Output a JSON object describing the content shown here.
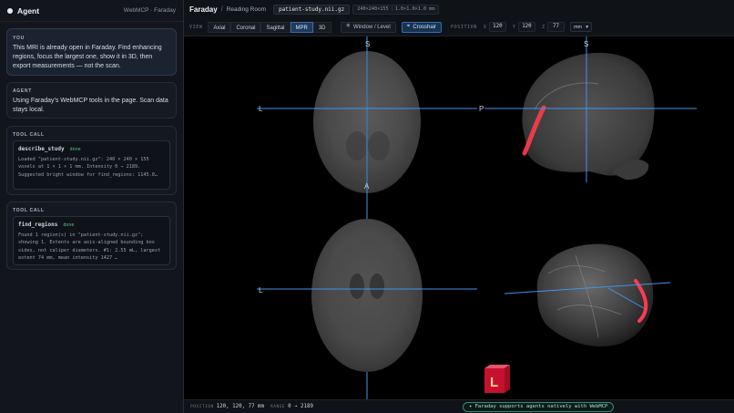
{
  "agent_panel": {
    "title": "Agent",
    "meta": "WebMCP · Faraday",
    "user_message": {
      "label": "YOU",
      "text": "This MRI is already open in Faraday. Find enhancing regions, focus the largest one, show it in 3D, then export measurements — not the scan."
    },
    "agent_message": {
      "label": "AGENT",
      "text": "Using Faraday's WebMCP tools in the page. Scan data stays local."
    },
    "tool_calls": [
      {
        "label": "TOOL CALL",
        "name": "describe_study",
        "status": "done",
        "output": "Loaded \"patient-study.nii.gz\": 240 × 240 × 155 voxels at 1 × 1 × 1 mm. Intensity 0 → 2189. Suggested bright window for find_regions: 1145.0…"
      },
      {
        "label": "TOOL CALL",
        "name": "find_regions",
        "status": "done",
        "output": "Found 1 region(s) in \"patient-study.nii.gz\"; showing 1. Extents are axis-aligned bounding box sides, not caliper diameters. #1: 2.55 mL, largest extent 74 mm, mean intensity 1427 …"
      }
    ]
  },
  "topbar": {
    "brand": "Faraday",
    "separator": "/",
    "room": "Reading Room",
    "filename": "patient-study.nii.gz",
    "dims": "240×240×155",
    "spacing": "1.0×1.0×1.0 mm"
  },
  "viewbar": {
    "view_caption": "VIEW",
    "views": [
      "Axial",
      "Coronal",
      "Sagittal",
      "MPR",
      "3D"
    ],
    "active_view": "MPR",
    "window_level_label": "Window / Level",
    "crosshair_label": "Crosshair",
    "position_caption": "POSITION",
    "position": {
      "x": "120",
      "y": "120",
      "z": "77"
    },
    "unit": "mm"
  },
  "viewer": {
    "orientation_labels": {
      "axial_top": "S",
      "axial_left": "L",
      "sagittal_top": "S",
      "sagittal_left": "P",
      "coronal_top": "A",
      "coronal_left": "L"
    },
    "orientation_cube_label": "L",
    "colors": {
      "crosshair": "#3f95e8",
      "region": "#ff3b4e",
      "cube": "#c8102e"
    }
  },
  "statusbar": {
    "position_caption": "POSITION",
    "position_value": "120, 120, 77 mm",
    "range_caption": "RANGE",
    "range_value": "0 → 2189",
    "badge": "✦ Faraday supports agents natively with WebMCP"
  }
}
